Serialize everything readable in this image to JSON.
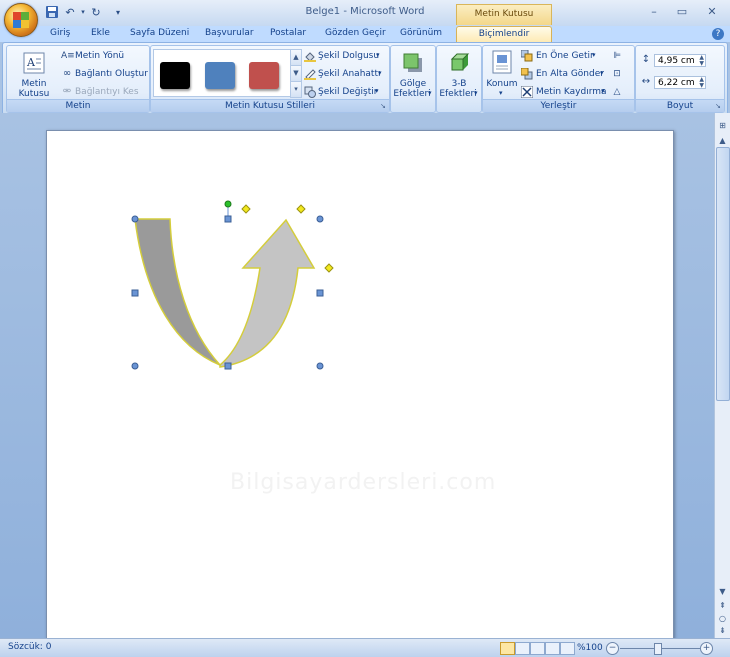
{
  "app": {
    "window_title": "Belge1 - Microsoft Word",
    "context_tools_title": "Metin Kutusu Araçları"
  },
  "tabs": [
    {
      "label": "Giriş"
    },
    {
      "label": "Ekle"
    },
    {
      "label": "Sayfa Düzeni"
    },
    {
      "label": "Başvurular"
    },
    {
      "label": "Postalar"
    },
    {
      "label": "Gözden Geçir"
    },
    {
      "label": "Görünüm"
    },
    {
      "label": "Biçimlendir",
      "active": true
    }
  ],
  "ribbon": {
    "metin": {
      "group_label": "Metin",
      "draw_textbox": "Metin Kutusu Çiz",
      "text_direction": "Metin Yönü",
      "create_link": "Bağlantı Oluştur",
      "break_link": "Bağlantıyı Kes"
    },
    "styles": {
      "group_label": "Metin Kutusu Stilleri",
      "swatches": [
        {
          "color": "#000000"
        },
        {
          "color": "#4f81bd"
        },
        {
          "color": "#c0504d"
        }
      ],
      "shape_fill": "Şekil Dolgusu",
      "shape_outline": "Şekil Anahattı",
      "change_shape": "Şekil Değiştir"
    },
    "shadow": {
      "label_1": "Gölge",
      "label_2": "Efektleri"
    },
    "three_d": {
      "label_1": "3-B",
      "label_2": "Efektleri"
    },
    "arrange": {
      "group_label": "Yerleştir",
      "position": "Konum",
      "bring_front": "En Öne Getir",
      "send_back": "En Alta Gönder",
      "text_wrap": "Metin Kaydırma"
    },
    "size": {
      "group_label": "Boyut",
      "height": "4,95 cm",
      "width": "6,22 cm"
    }
  },
  "document": {
    "watermark": "Bilgisayardersleri.com",
    "shape": {
      "fill_light": "#c4c4c4",
      "fill_dark": "#9a9a9a",
      "outline": "#d4cd3c",
      "handle_color": "#6a94d4",
      "adjust_color": "#f2e81f",
      "rotate_color": "#2bc02b"
    }
  },
  "statusbar": {
    "word_count": "Sözcük: 0",
    "zoom": "%100"
  }
}
